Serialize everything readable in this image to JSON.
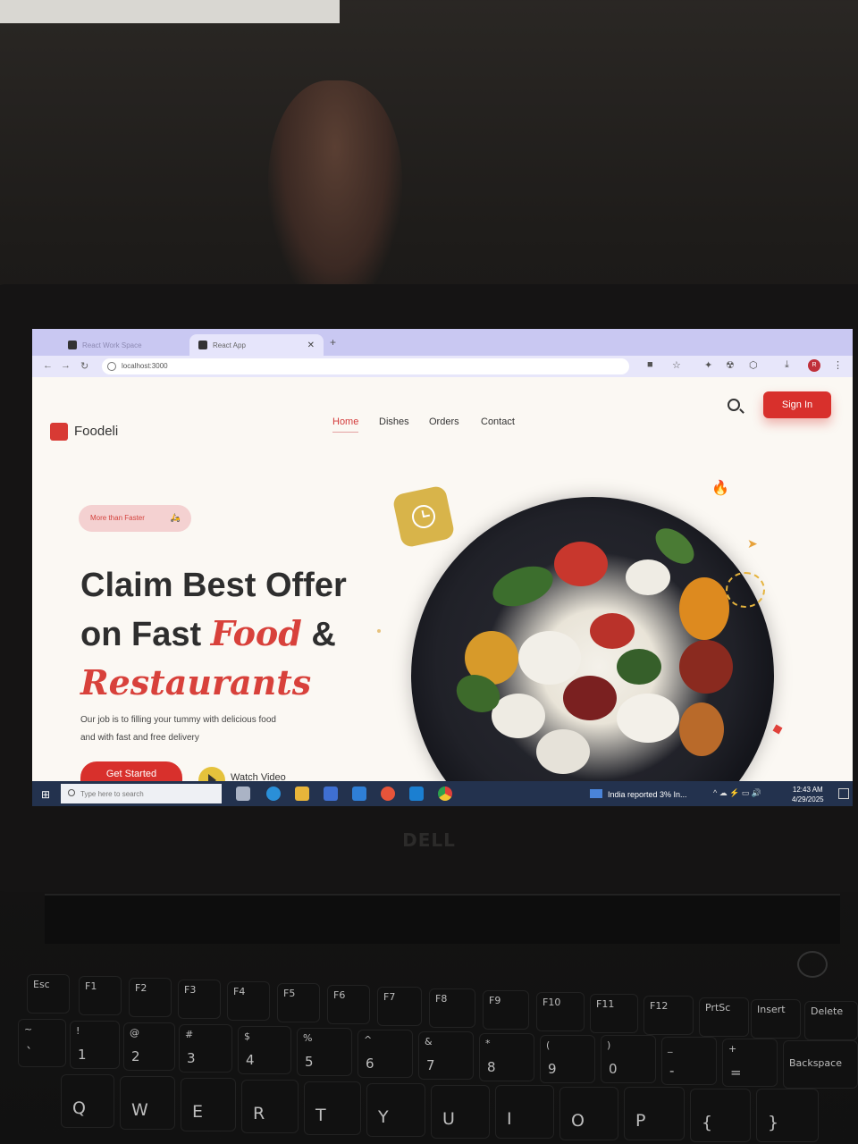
{
  "browser": {
    "tabs": [
      {
        "label": "React Work Space"
      },
      {
        "label": "React App"
      }
    ],
    "url": "localhost:3000"
  },
  "site": {
    "logo": "Foodeli",
    "nav": [
      "Home",
      "Dishes",
      "Orders",
      "Contact"
    ],
    "active_nav": "Home",
    "signin_label": "Sign In",
    "pill_label": "More than Faster",
    "headline": {
      "line1": "Claim Best Offer",
      "line2a": "on Fast ",
      "line2_accent": "Food",
      "line2b": " &",
      "line3_accent": "Restaurants"
    },
    "description_l1": "Our job is to filling your tummy with delicious food",
    "description_l2": "and  with fast and free delivery",
    "cta_label": "Get Started",
    "watch_label": "Watch Video"
  },
  "taskbar": {
    "search_placeholder": "Type here to search",
    "news": "India reported 3% In...",
    "time": "12:43 AM",
    "date": "4/29/2025"
  },
  "device": {
    "brand": "DELL"
  },
  "keyboard": {
    "row_fn": [
      "Esc",
      "F1",
      "F2",
      "F3",
      "F4",
      "F5",
      "F6",
      "F7",
      "F8",
      "F9",
      "F10",
      "F11",
      "F12",
      "PrtSc",
      "Insert",
      "Delete"
    ],
    "row_num_top": [
      "~",
      "!",
      "@",
      "#",
      "$",
      "%",
      "^",
      "&",
      "*",
      "(",
      ")",
      "_",
      "+"
    ],
    "row_num": [
      "`",
      "1",
      "2",
      "3",
      "4",
      "5",
      "6",
      "7",
      "8",
      "9",
      "0",
      "-",
      "=",
      "Backspace"
    ],
    "row_q": [
      "Q",
      "W",
      "E",
      "R",
      "T",
      "Y",
      "U",
      "I",
      "O",
      "P",
      "{",
      "}"
    ]
  },
  "colors": {
    "brand_red": "#d8302c",
    "accent_yellow": "#d8b44a",
    "page_bg": "#fbf8f3",
    "taskbar": "#23324e",
    "tabbar": "#c9c8f2"
  }
}
